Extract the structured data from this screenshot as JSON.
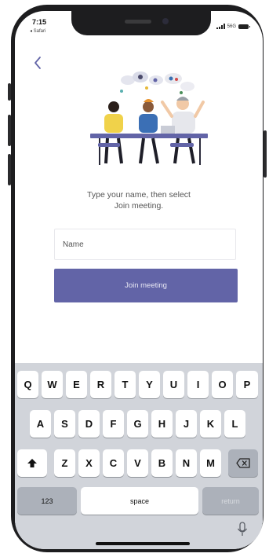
{
  "status_bar": {
    "time": "7:15",
    "back_app": "◂ Safari",
    "carrier": "56G"
  },
  "prompt": {
    "line1": "Type your name, then select",
    "line2": "Join meeting."
  },
  "name_input": {
    "placeholder": "Name",
    "value": ""
  },
  "join_button": {
    "label": "Join meeting"
  },
  "keyboard": {
    "row1": [
      "Q",
      "W",
      "E",
      "R",
      "T",
      "Y",
      "U",
      "I",
      "O",
      "P"
    ],
    "row2": [
      "A",
      "S",
      "D",
      "F",
      "G",
      "H",
      "J",
      "K",
      "L"
    ],
    "row3": [
      "Z",
      "X",
      "C",
      "V",
      "B",
      "N",
      "M"
    ],
    "numbers_label": "123",
    "space_label": "space",
    "return_label": "return"
  },
  "colors": {
    "accent": "#6264a7",
    "keyboard_bg": "#d1d4da"
  },
  "icons": {
    "back": "chevron-left-icon",
    "shift": "shift-icon",
    "delete": "backspace-icon",
    "mic": "microphone-icon"
  }
}
